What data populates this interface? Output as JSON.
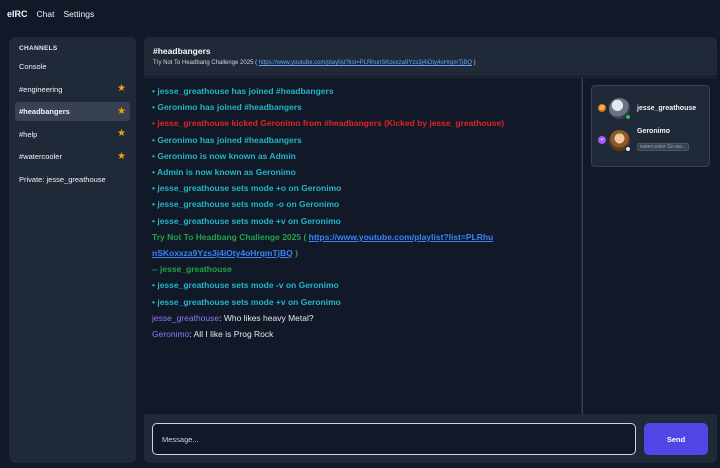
{
  "app": {
    "title": "eIRC",
    "menu": [
      "Chat",
      "Settings"
    ]
  },
  "sidebar": {
    "section_title": "CHANNELS",
    "items": [
      {
        "label": "Console",
        "starred": false,
        "active": false
      },
      {
        "label": "#engineering",
        "starred": true,
        "active": false
      },
      {
        "label": "#headbangers",
        "starred": true,
        "active": true
      },
      {
        "label": "#help",
        "starred": true,
        "active": false
      },
      {
        "label": "#watercooler",
        "starred": true,
        "active": false
      },
      {
        "label": "Private: jesse_greathouse",
        "starred": false,
        "active": false
      }
    ]
  },
  "channel": {
    "name": "#headbangers",
    "topic_prefix": "Try Not To Headbang Challenge 2025 ( ",
    "topic_url": "https://www.youtube.com/playlist?list=PLRhunSKoxxza9Yzs3j4iOty4oHrqmTjBQ",
    "topic_suffix": " )"
  },
  "messages": {
    "m1": "• jesse_greathouse has joined #headbangers",
    "m2": "• Geronimo has joined #headbangers",
    "m3": "• jesse_greathouse kicked Geronimo from #headbangers (Kicked by jesse_greathouse)",
    "m4": "• Geronimo has joined #headbangers",
    "m5": "• Geronimo is now known as Admin",
    "m6": "• Admin is now known as Geronimo",
    "m7": "• jesse_greathouse sets mode +o on Geronimo",
    "m8": "• jesse_greathouse sets mode -o on Geronimo",
    "m9": "• jesse_greathouse sets mode +v on Geronimo",
    "topic_prefix": "Try Not To Headbang Challenge 2025 ( ",
    "topic_url": "https://www.youtube.com/playlist?list=PLRhunSKoxxza9Yzs3j4iOty4oHrqmTjBQ",
    "topic_suffix": " )",
    "topic_setter": "-- jesse_greathouse",
    "m10": "• jesse_greathouse sets mode -v on Geronimo",
    "m11": "• jesse_greathouse sets mode +v on Geronimo",
    "chat1_nick": "jesse_greathouse",
    "chat1_text": ": Who likes heavy Metal?",
    "chat2_nick": "Geronimo",
    "chat2_text": ": All I like is Prog Rock"
  },
  "users": {
    "u1": {
      "name": "jesse_greathouse",
      "rank": "operator",
      "status": "online"
    },
    "u2": {
      "name": "Geronimo",
      "rank": "voice",
      "status": "away",
      "away_text": "watercooler Go aw..."
    }
  },
  "composer": {
    "placeholder": "Message...",
    "send_label": "Send"
  },
  "colors": {
    "system": "#22b7c9",
    "kick": "#dc2626",
    "topic": "#22a34a",
    "nick": "#8b7cf8",
    "accent": "#4f46e5",
    "star": "#f59e0b"
  }
}
